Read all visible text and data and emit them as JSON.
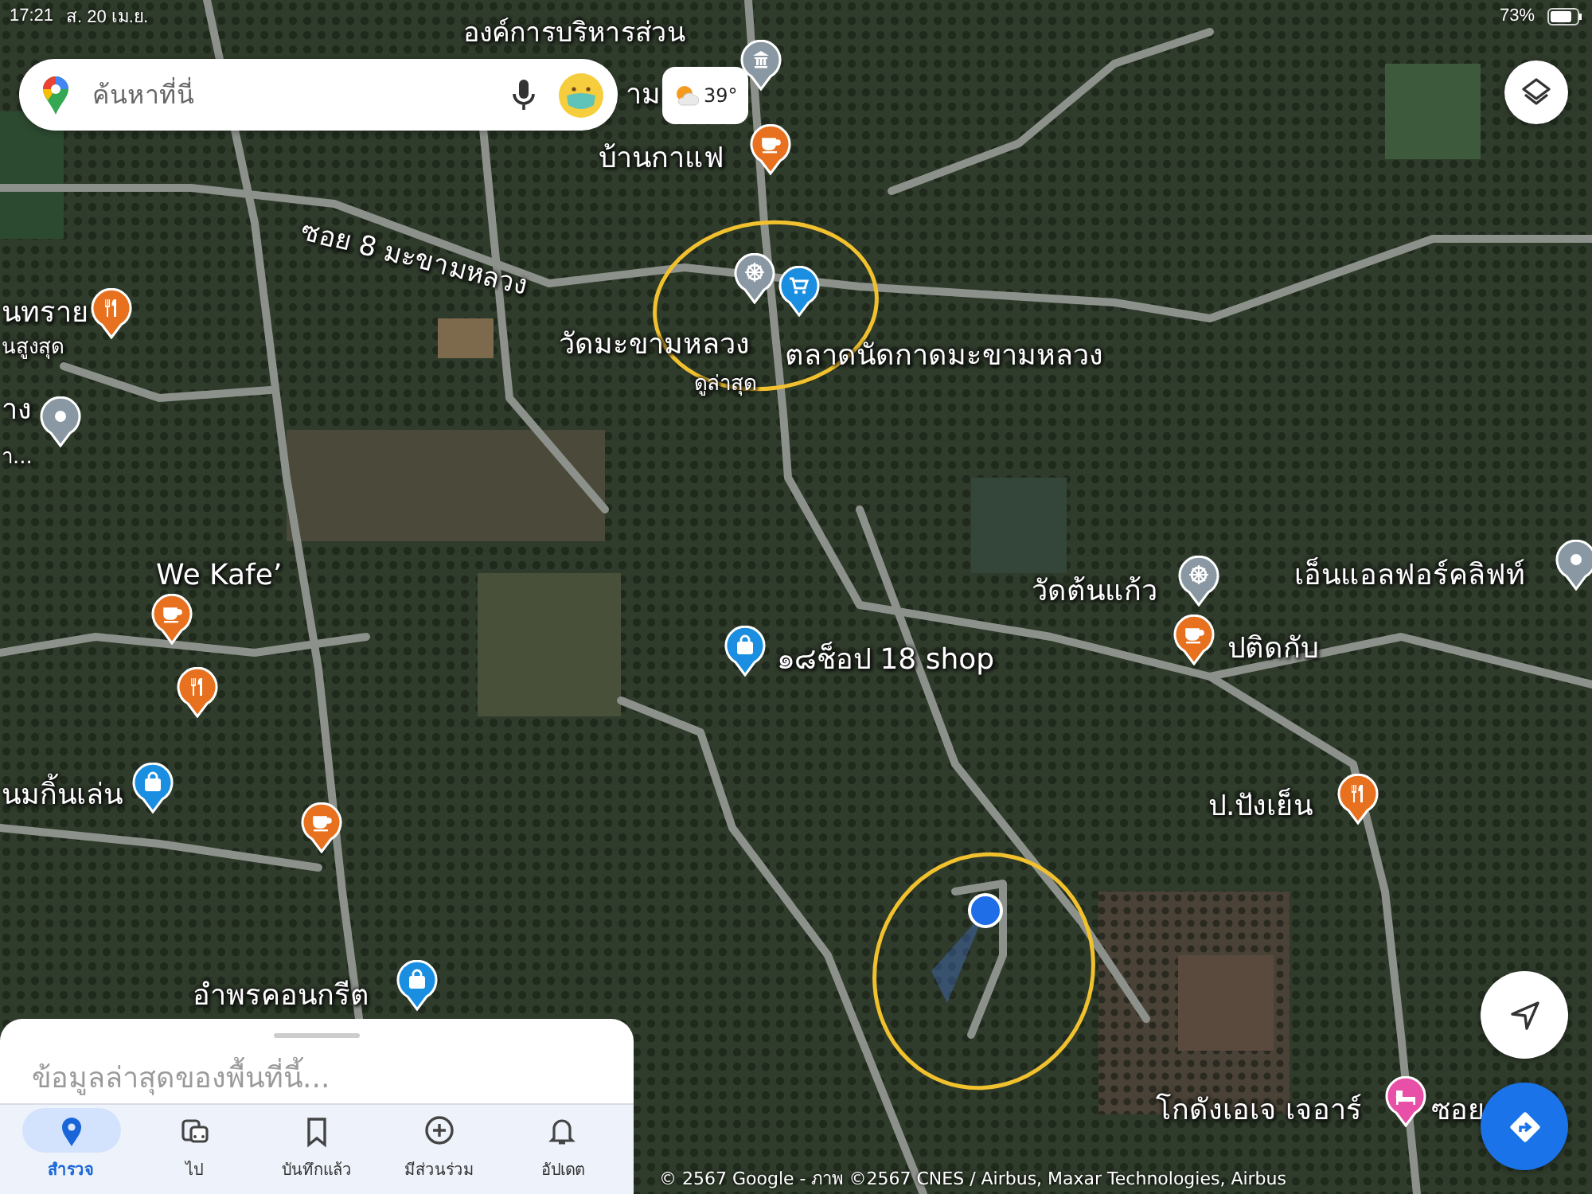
{
  "status_bar": {
    "time": "17:21",
    "date": "ส. 20 เม.ย.",
    "battery": "73%"
  },
  "search": {
    "placeholder": "ค้นหาที่นี่"
  },
  "weather": {
    "temperature": "39°"
  },
  "map": {
    "labels": [
      {
        "text": "องค์การบริหารส่วน",
        "kind": "place"
      },
      {
        "text": "าม",
        "kind": "place"
      },
      {
        "text": "บ้านกาแฟ",
        "kind": "place"
      },
      {
        "text": "ซอย 8 มะขามหลวง",
        "kind": "road"
      },
      {
        "text": "วัดมะขามหลวง",
        "kind": "place"
      },
      {
        "text": "ดูล่าสุด",
        "kind": "note"
      },
      {
        "text": "ตลาดนัดกาดมะขามหลวง",
        "kind": "place"
      },
      {
        "text": "นทราย",
        "kind": "place"
      },
      {
        "text": "นสูงสุด",
        "kind": "note"
      },
      {
        "text": "าง",
        "kind": "place"
      },
      {
        "text": "า...",
        "kind": "note"
      },
      {
        "text": "We Kafe’",
        "kind": "place"
      },
      {
        "text": "นมกิ้นเล่น",
        "kind": "place"
      },
      {
        "text": "อำพรคอนกรีต",
        "kind": "place"
      },
      {
        "text": "๑๘ช็อป 18 shop",
        "kind": "place"
      },
      {
        "text": "วัดต้นแก้ว",
        "kind": "place"
      },
      {
        "text": "เอ็นแอลฟอร์คลิฟท์",
        "kind": "place"
      },
      {
        "text": "ปติดกับ",
        "kind": "place"
      },
      {
        "text": "ป.ปังเย็น",
        "kind": "place"
      },
      {
        "text": "โกดังเอเจ เจอาร์",
        "kind": "place"
      },
      {
        "text": "ซอย",
        "kind": "road"
      }
    ],
    "pins": [
      {
        "kind": "museum"
      },
      {
        "kind": "cafe"
      },
      {
        "kind": "temple"
      },
      {
        "kind": "cart"
      },
      {
        "kind": "restaurant"
      },
      {
        "kind": "place"
      },
      {
        "kind": "cafe"
      },
      {
        "kind": "restaurant"
      },
      {
        "kind": "shop"
      },
      {
        "kind": "cafe"
      },
      {
        "kind": "shop"
      },
      {
        "kind": "shop"
      },
      {
        "kind": "temple"
      },
      {
        "kind": "cafe"
      },
      {
        "kind": "place"
      },
      {
        "kind": "restaurant"
      },
      {
        "kind": "hotel"
      }
    ],
    "attribution": "© 2567 Google - ภาพ ©2567 CNES / Airbus, Maxar Technologies, Airbus"
  },
  "bottom_sheet": {
    "heading": "ข้อมูลล่าสุดของพื้นที่นี้..."
  },
  "nav_tabs": [
    {
      "label": "สำรวจ",
      "kind": "explore",
      "selected": true
    },
    {
      "label": "ไป",
      "kind": "go",
      "selected": false
    },
    {
      "label": "บันทึกแล้ว",
      "kind": "saved",
      "selected": false
    },
    {
      "label": "มีส่วนร่วม",
      "kind": "contribute",
      "selected": false
    },
    {
      "label": "อัปเดต",
      "kind": "updates",
      "selected": false
    }
  ]
}
